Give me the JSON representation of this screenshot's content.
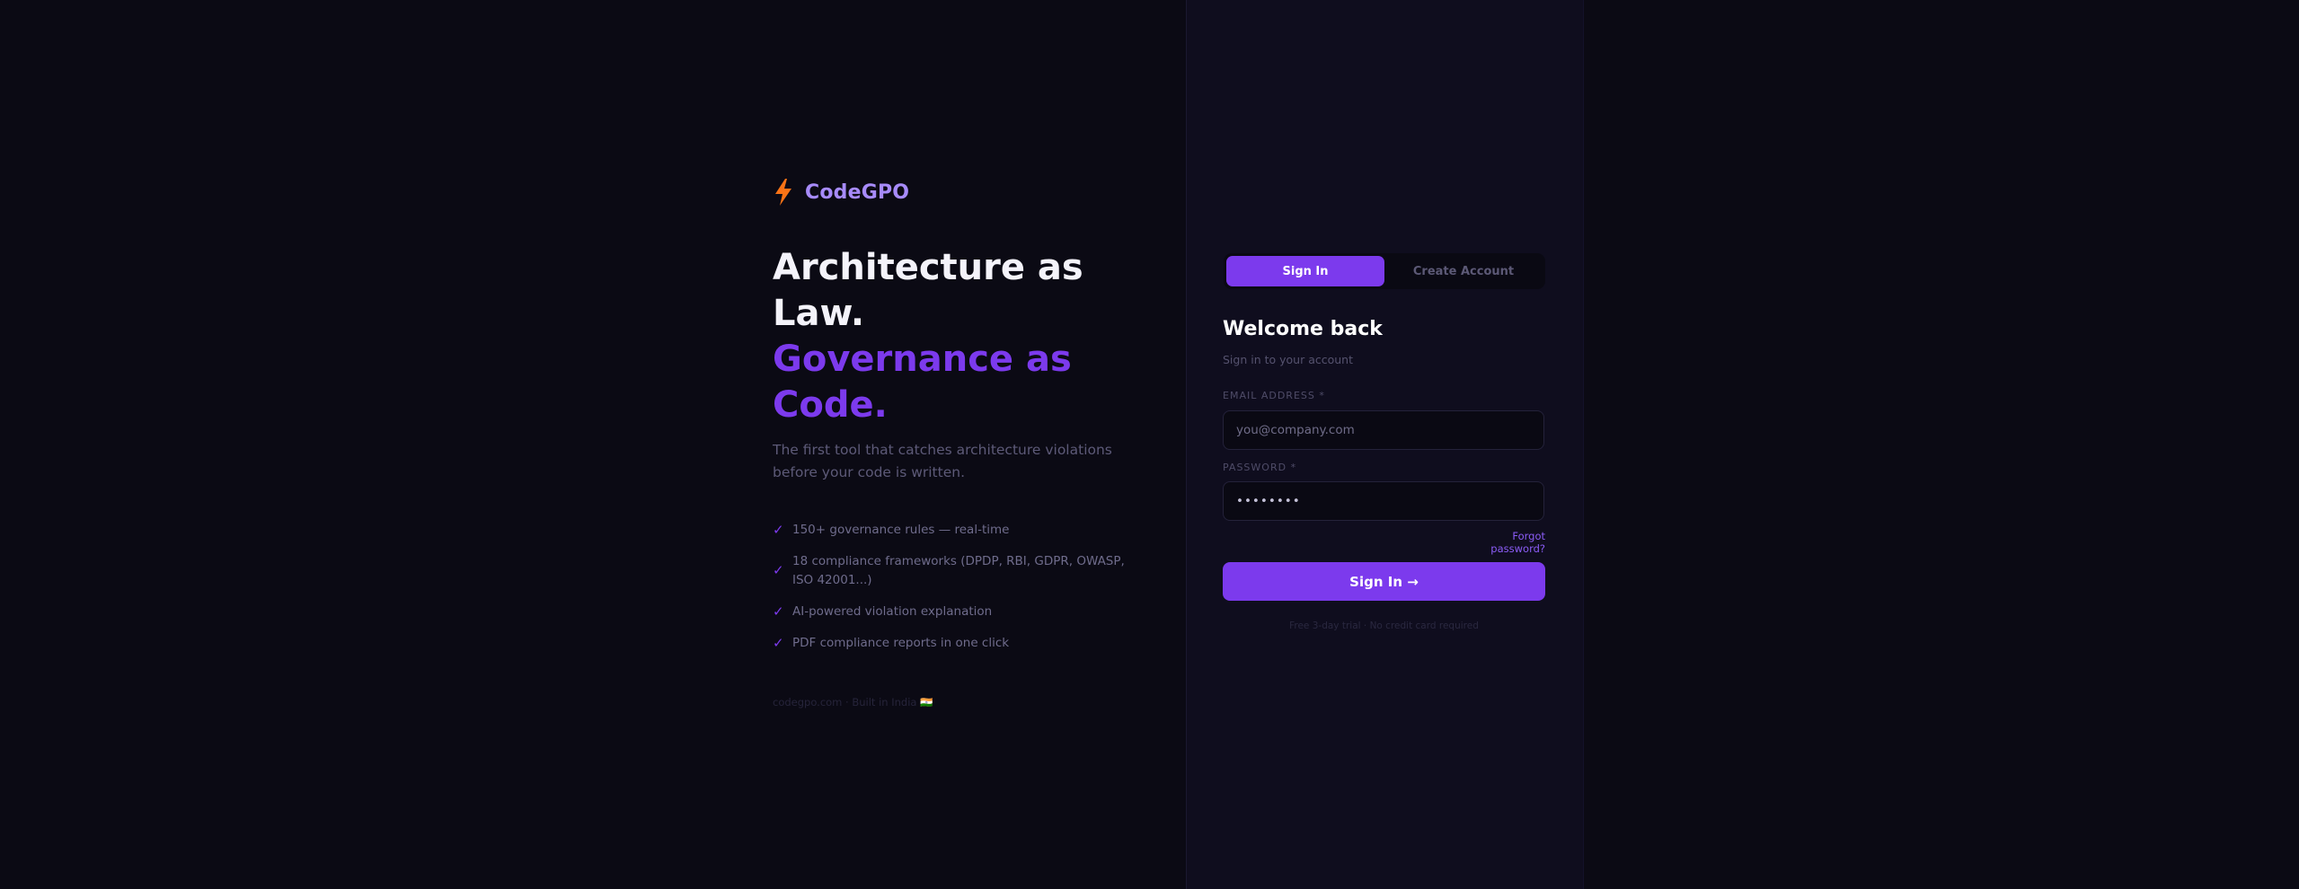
{
  "brand": {
    "name": "CodeGPO",
    "icon": "lightning-bolt-icon",
    "icon_color": "#f97316"
  },
  "hero": {
    "headline_line1": "Architecture as",
    "headline_line2": "Law.",
    "headline_line3": "Governance as",
    "headline_line4": "Code.",
    "subtitle": "The first tool that catches architecture violations before your code is written."
  },
  "features": [
    {
      "check": "✓",
      "text": "150+ governance rules — real-time"
    },
    {
      "check": "✓",
      "text": "18 compliance frameworks (DPDP, RBI, GDPR, OWASP, ISO 42001...)"
    },
    {
      "check": "✓",
      "text": "AI-powered violation explanation"
    },
    {
      "check": "✓",
      "text": "PDF compliance reports in one click"
    }
  ],
  "footer_note": "codegpo.com · Built in India 🇮🇳",
  "auth": {
    "tabs": {
      "sign_in": "Sign In",
      "create_account": "Create Account"
    },
    "title": "Welcome back",
    "subtitle": "Sign in to your account",
    "email": {
      "label": "EMAIL ADDRESS *",
      "placeholder": "you@company.com",
      "value": ""
    },
    "password": {
      "label": "PASSWORD *",
      "value": "••••••••"
    },
    "forgot_password": "Forgot password?",
    "submit": "Sign In →",
    "trial_note": "Free 3-day trial · No credit card required"
  },
  "colors": {
    "background": "#0b0a14",
    "panel": "#0f0d1e",
    "accent": "#7c3aed",
    "brand_text": "#a78bfa"
  }
}
